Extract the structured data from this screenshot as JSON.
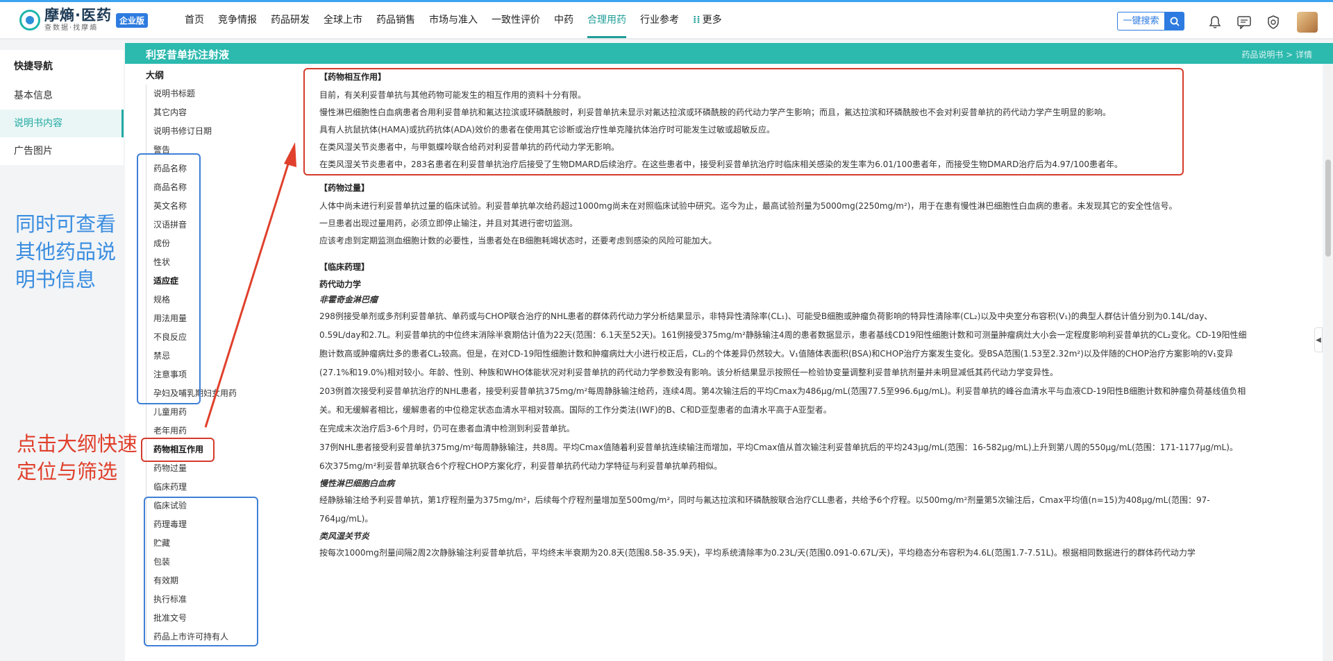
{
  "header": {
    "logo_main": "摩熵·医药",
    "logo_sub": "查数据·找摩熵",
    "enterprise_badge": "企业版",
    "nav": [
      "首页",
      "竞争情报",
      "药品研发",
      "全球上市",
      "药品销售",
      "市场与准入",
      "一致性评价",
      "中药",
      "合理用药",
      "行业参考",
      "更多"
    ],
    "active_nav": "合理用药",
    "search_label": "一键搜索"
  },
  "quick_nav": {
    "title": "快捷导航",
    "items": [
      "基本信息",
      "说明书内容",
      "广告图片"
    ],
    "active": "说明书内容"
  },
  "band": {
    "title": "利妥昔单抗注射液",
    "breadcrumb": "药品说明书 > 详情"
  },
  "outline": {
    "title": "大纲",
    "items": [
      "说明书标题",
      "其它内容",
      "说明书修订日期",
      "警告",
      "药品名称",
      "商品名称",
      "英文名称",
      "汉语拼音",
      "成份",
      "性状",
      "适应症",
      "规格",
      "用法用量",
      "不良反应",
      "禁忌",
      "注意事项",
      "孕妇及哺乳期妇女用药",
      "儿童用药",
      "老年用药",
      "药物相互作用",
      "药物过量",
      "临床药理",
      "临床试验",
      "药理毒理",
      "贮藏",
      "包装",
      "有效期",
      "执行标准",
      "批准文号",
      "药品上市许可持有人"
    ],
    "bold_items": [
      "适应症",
      "药物相互作用"
    ]
  },
  "content": {
    "interaction_title": "【药物相互作用】",
    "interaction_paras": [
      "目前，有关利妥昔单抗与其他药物可能发生的相互作用的资料十分有限。",
      "慢性淋巴细胞性白血病患者合用利妥昔单抗和氟达拉滨或环磷酰胺时，利妥昔单抗未显示对氟达拉滨或环磷酰胺的药代动力学产生影响；而且，氟达拉滨和环磷酰胺也不会对利妥昔单抗的药代动力学产生明显的影响。",
      "具有人抗鼠抗体(HAMA)或抗药抗体(ADA)效价的患者在使用其它诊断或治疗性单克隆抗体治疗时可能发生过敏或超敏反应。",
      "在类风湿关节炎患者中，与甲氨蝶呤联合给药对利妥昔单抗的药代动力学无影响。",
      "在类风湿关节炎患者中，283名患者在利妥昔单抗治疗后接受了生物DMARD后续治疗。在这些患者中，接受利妥昔单抗治疗时临床相关感染的发生率为6.01/100患者年，而接受生物DMARD治疗后为4.97/100患者年。"
    ],
    "overdose_title": "【药物过量】",
    "overdose_paras": [
      "人体中尚未进行利妥昔单抗过量的临床试验。利妥昔单抗单次给药超过1000mg尚未在对照临床试验中研究。迄今为止，最高试验剂量为5000mg(2250mg/m²)，用于在患有慢性淋巴细胞性白血病的患者。未发现其它的安全性信号。",
      "一旦患者出现过量用药，必须立即停止输注，并且对其进行密切监测。",
      "应该考虑到定期监测血细胞计数的必要性，当患者处在B细胞耗竭状态时，还要考虑到感染的风险可能加大。"
    ],
    "pharm_title": "【临床药理】",
    "pk_title": "药代动力学",
    "nhl_title": "非霍奇金淋巴瘤",
    "nhl_paras": [
      "298例接受单剂或多剂利妥昔单抗、单药或与CHOP联合治疗的NHL患者的群体药代动力学分析结果显示，非特异性清除率(CL₁)、可能受B细胞或肿瘤负荷影响的特异性清除率(CL₂)以及中央室分布容积(V₁)的典型人群估计值分别为0.14L/day、0.59L/day和2.7L。利妥昔单抗的中位终末消除半衰期估计值为22天(范围：6.1天至52天)。161例接受375mg/m²静脉输注4周的患者数据显示，患者基线CD19阳性细胞计数和可测量肿瘤病灶大小会一定程度影响利妥昔单抗的CL₂变化。CD-19阳性细胞计数高或肿瘤病灶多的患者CL₂较高。但是，在对CD-19阳性细胞计数和肿瘤病灶大小进行校正后，CL₂的个体差异仍然较大。V₁值随体表面积(BSA)和CHOP治疗方案发生变化。受BSA范围(1.53至2.32m²)以及伴随的CHOP治疗方案影响的V₁变异(27.1%和19.0%)相对较小。年龄、性别、种族和WHO体能状况对利妥昔单抗的药代动力学参数没有影响。该分析结果显示按照任一检验协变量调整利妥昔单抗剂量并未明显减低其药代动力学变异性。",
      "203例首次接受利妥昔单抗治疗的NHL患者，接受利妥昔单抗375mg/m²每周静脉输注给药，连续4周。第4次输注后的平均Cmax为486μg/mL(范围77.5至996.6μg/mL)。利妥昔单抗的峰谷血清水平与血液CD-19阳性B细胞计数和肿瘤负荷基线值负相关。和无缓解者相比，缓解患者的中位稳定状态血清水平相对较高。国际的工作分类法(IWF)的B、C和D亚型患者的血清水平高于A亚型者。",
      "在完成末次治疗后3-6个月时，仍可在患者血清中检测到利妥昔单抗。",
      "37例NHL患者接受利妥昔单抗375mg/m²每周静脉输注，共8周。平均Cmax值随着利妥昔单抗连续输注而增加，平均Cmax值从首次输注利妥昔单抗后的平均243μg/mL(范围：16-582μg/mL)上升到第八周的550μg/mL(范围：171-1177μg/mL)。",
      "6次375mg/m²利妥昔单抗联合6个疗程CHOP方案化疗，利妥昔单抗药代动力学特征与利妥昔单抗单药相似。"
    ],
    "cll_title": "慢性淋巴细胞白血病",
    "cll_para": "经静脉输注给予利妥昔单抗，第1疗程剂量为375mg/m²，后续每个疗程剂量增加至500mg/m²，同时与氟达拉滨和环磷酰胺联合治疗CLL患者，共给予6个疗程。以500mg/m²剂量第5次输注后，Cmax平均值(n=15)为408μg/mL(范围：97-764μg/mL)。",
    "ra_title": "类风湿关节炎",
    "ra_para": "按每次1000mg剂量间隔2周2次静脉输注利妥昔单抗后，平均终末半衰期为20.8天(范围8.58-35.9天)，平均系统清除率为0.23L/天(范围0.091-0.67L/天)，平均稳态分布容积为4.6L(范围1.7-7.51L)。根据相同数据进行的群体药代动力学"
  },
  "annotations": {
    "blue_text": "同时可查看其他药品说明书信息",
    "red_text": "点击大纲快速定位与筛选"
  },
  "colors": {
    "accent": "#2cb9ae",
    "nav_active": "#1f9e97",
    "brand_blue": "#2d7be0",
    "annotation_blue": "#3a8de0",
    "annotation_red": "#e0402c"
  }
}
